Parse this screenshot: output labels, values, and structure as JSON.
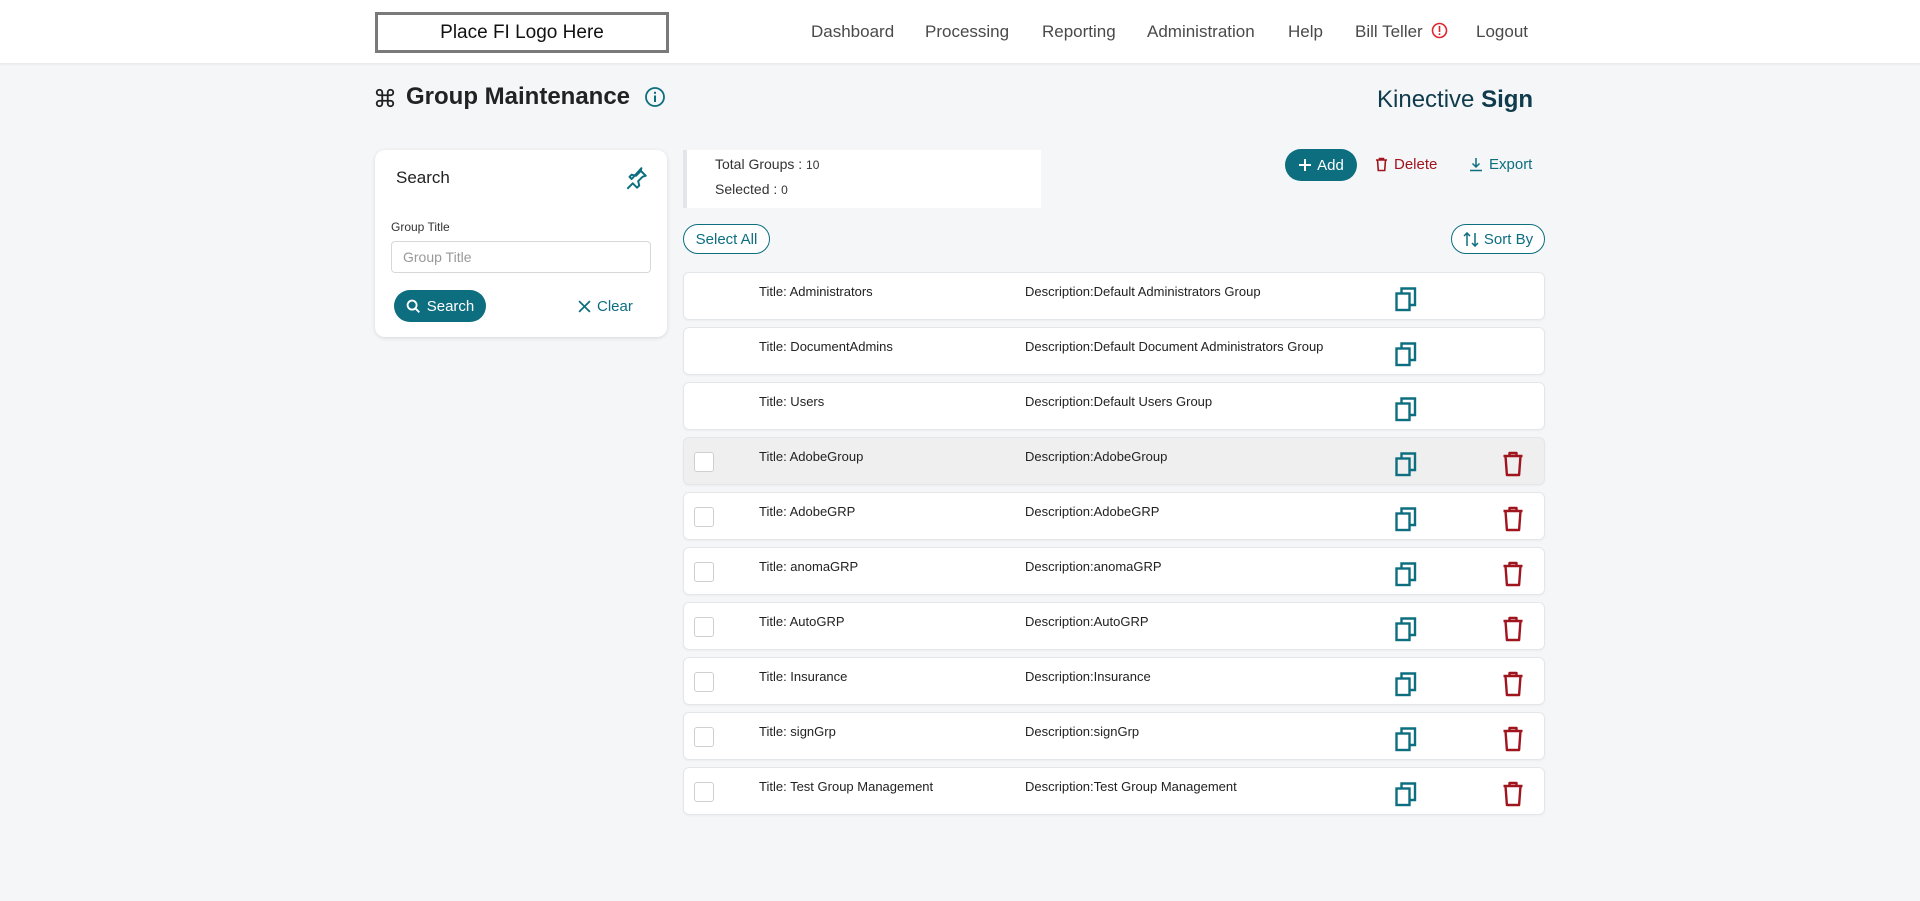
{
  "header": {
    "logo_text": "Place FI Logo Here",
    "nav": [
      "Dashboard",
      "Processing",
      "Reporting",
      "Administration",
      "Help",
      "Bill Teller",
      "Logout"
    ]
  },
  "page": {
    "title": "Group Maintenance",
    "brand_light": "Kinective ",
    "brand_bold": "Sign"
  },
  "search": {
    "title": "Search",
    "field_label": "Group Title",
    "placeholder": "Group Title",
    "value": "",
    "search_label": "Search",
    "clear_label": "Clear"
  },
  "summary": {
    "total_label": "Total Groups : ",
    "total_value": "10",
    "selected_label": "Selected : ",
    "selected_value": "0"
  },
  "toolbar": {
    "add_label": "Add",
    "delete_label": "Delete",
    "export_label": "Export",
    "select_all_label": "Select All",
    "sort_label": "Sort By"
  },
  "groups": [
    {
      "title": "Title: Administrators",
      "description": "Description:Default Administrators Group",
      "deletable": false,
      "highlighted": false
    },
    {
      "title": "Title: DocumentAdmins",
      "description": "Description:Default Document Administrators Group",
      "deletable": false,
      "highlighted": false
    },
    {
      "title": "Title: Users",
      "description": "Description:Default Users Group",
      "deletable": false,
      "highlighted": false
    },
    {
      "title": "Title: AdobeGroup",
      "description": "Description:AdobeGroup",
      "deletable": true,
      "highlighted": true
    },
    {
      "title": "Title: AdobeGRP",
      "description": "Description:AdobeGRP",
      "deletable": true,
      "highlighted": false
    },
    {
      "title": "Title: anomaGRP",
      "description": "Description:anomaGRP",
      "deletable": true,
      "highlighted": false
    },
    {
      "title": "Title: AutoGRP",
      "description": "Description:AutoGRP",
      "deletable": true,
      "highlighted": false
    },
    {
      "title": "Title: Insurance",
      "description": "Description:Insurance",
      "deletable": true,
      "highlighted": false
    },
    {
      "title": "Title: signGrp",
      "description": "Description:signGrp",
      "deletable": true,
      "highlighted": false
    },
    {
      "title": "Title: Test Group Management",
      "description": "Description:Test Group Management",
      "deletable": true,
      "highlighted": false
    }
  ],
  "colors": {
    "accent": "#0d6e80",
    "danger": "#a0141e",
    "warning": "#e0262b"
  }
}
